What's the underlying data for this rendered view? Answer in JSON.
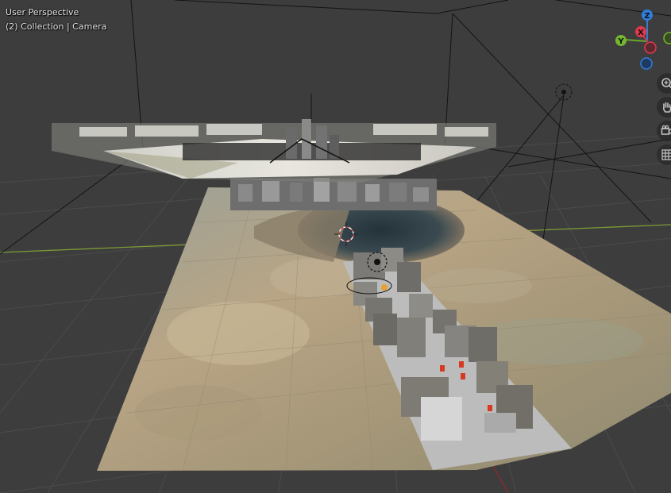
{
  "viewport": {
    "mode_label": "User Perspective",
    "collection_label": "(2) Collection | Camera"
  },
  "gizmo": {
    "axes": [
      {
        "name": "Z",
        "color": "#2f7fdc"
      },
      {
        "name": "X",
        "color": "#e0394c"
      },
      {
        "name": "Y",
        "color": "#74b62e"
      }
    ]
  },
  "nav_tools": [
    {
      "icon": "zoom-icon"
    },
    {
      "icon": "pan-hand-icon"
    },
    {
      "icon": "camera-icon"
    },
    {
      "icon": "grid-view-icon"
    }
  ],
  "colors": {
    "background": "#3d3d3d",
    "grid": "#4a4a4a",
    "x_axis": "#8a9d3c",
    "y_axis": "#8a2c2c",
    "terrain": "#b39d7c"
  }
}
